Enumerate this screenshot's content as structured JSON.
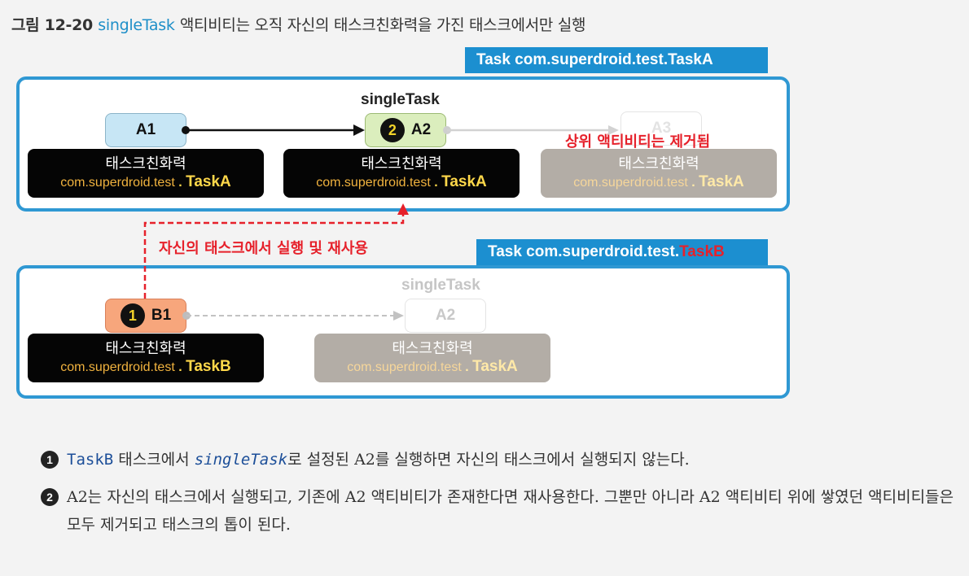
{
  "figure": {
    "number": "그림 12-20",
    "caption_keyword": "singleTask",
    "caption_rest": "액티비티는 오직 자신의 태스크친화력을 가진 태스크에서만 실행"
  },
  "taskA": {
    "tab_label": "Task com.superdroid.test.TaskA",
    "single_task_label": "singleTask",
    "removed_note": "상위 액티비티는 제거됨",
    "activities": [
      {
        "label": "A1",
        "badge": ""
      },
      {
        "label": "A2",
        "badge": "2"
      },
      {
        "label": "A3",
        "badge": ""
      }
    ],
    "affinities": [
      {
        "title": "태스크친화력",
        "package": "com.superdroid.test",
        "dot": ".",
        "name": "TaskA"
      },
      {
        "title": "태스크친화력",
        "package": "com.superdroid.test",
        "dot": ".",
        "name": "TaskA"
      },
      {
        "title": "태스크친화력",
        "package": "com.superdroid.test",
        "dot": ".",
        "name": "TaskA"
      }
    ]
  },
  "taskB": {
    "tab_prefix": "Task com.superdroid.test.",
    "tab_suffix": "TaskB",
    "single_task_label": "singleTask",
    "activities": [
      {
        "label": "B1",
        "badge": "1"
      },
      {
        "label": "A2",
        "badge": ""
      }
    ],
    "affinities": [
      {
        "title": "태스크친화력",
        "package": "com.superdroid.test",
        "dot": ".",
        "name": "TaskB"
      },
      {
        "title": "태스크친화력",
        "package": "com.superdroid.test",
        "dot": ".",
        "name": "TaskA"
      }
    ]
  },
  "reuse_note": "자신의 태스크에서 실행 및 재사용",
  "notes": [
    {
      "marker": "1",
      "code": "TaskB",
      "text1": " 태스크에서 ",
      "code2": "singleTask",
      "text2": "로 설정된 A2를 실행하면 자신의 태스크에서 실행되지 않는다."
    },
    {
      "marker": "2",
      "text": "A2는 자신의 태스크에서 실행되고, 기존에 A2 액티비티가 존재한다면 재사용한다. 그뿐만 아니라 A2 액티비티 위에 쌓였던 액티비티들은 모두 제거되고 태스크의 톱이 된다."
    }
  ],
  "colors": {
    "task_border": "#2f98d3",
    "tab_bg": "#1c8fd0",
    "accent_red": "#e6212b",
    "badge_yellow": "#f1d22a"
  }
}
